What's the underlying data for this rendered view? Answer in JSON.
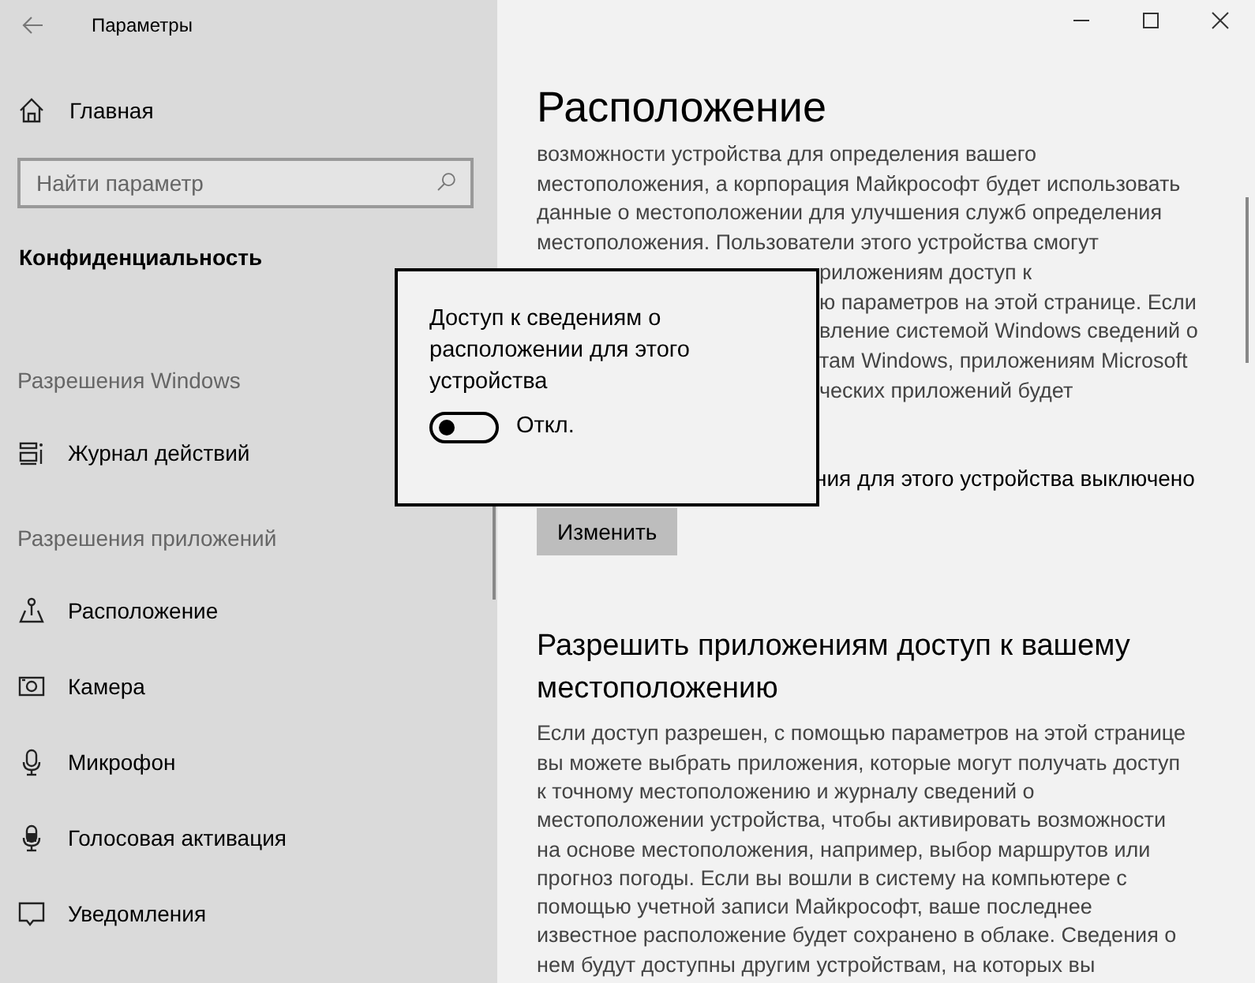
{
  "window": {
    "title": "Параметры"
  },
  "sidebar": {
    "home": "Главная",
    "search": {
      "placeholder": "Найти параметр"
    },
    "section": "Конфиденциальность",
    "groups": [
      {
        "heading": "Разрешения Windows",
        "items": [
          {
            "label": "Журнал действий",
            "kind": "history"
          }
        ]
      },
      {
        "heading": "Разрешения приложений",
        "items": [
          {
            "label": "Расположение",
            "kind": "location"
          },
          {
            "label": "Камера",
            "kind": "camera"
          },
          {
            "label": "Микрофон",
            "kind": "mic"
          },
          {
            "label": "Голосовая активация",
            "kind": "voice"
          },
          {
            "label": "Уведомления",
            "kind": "notify"
          }
        ]
      }
    ]
  },
  "page": {
    "title": "Расположение",
    "intro_lines": [
      {
        "text": "возможности устройства для определения вашего",
        "covered": false
      },
      {
        "text": "местоположения, а корпорация Майкрософт будет использовать",
        "covered": false
      },
      {
        "text": "данные о местоположении для улучшения служб определения",
        "covered": false
      },
      {
        "text": "местоположения. Пользователи этого устройства смогут",
        "covered": false
      },
      {
        "text": "риложениям доступ к",
        "covered": true
      },
      {
        "text": "ю параметров на этой странице. Если",
        "covered": true
      },
      {
        "text": "вление системой Windows сведений о",
        "covered": true
      },
      {
        "text": "там Windows, приложениям Microsoft",
        "covered": true
      },
      {
        "text": "ческих приложений будет",
        "covered": true
      }
    ],
    "status": "ния для этого устройства выключено",
    "change_button": "Изменить",
    "section": {
      "title": "Разрешить приложениям доступ к вашему местоположению",
      "lines": [
        "Если доступ разрешен, с помощью параметров на этой странице",
        "вы можете выбрать приложения, которые могут получать доступ",
        "к точному местоположению и журналу сведений о",
        "местоположении устройства, чтобы активировать возможности",
        "на основе местоположения, например, выбор маршрутов или",
        "прогноз погоды. Если вы вошли в систему на компьютере с",
        "помощью учетной записи Майкрософт, ваше последнее",
        "известное расположение будет сохранено в облаке. Сведения о",
        "нем будут доступны другим устройствам, на которых вы"
      ]
    }
  },
  "dialog": {
    "title": "Доступ к сведениям о расположении для этого устройства",
    "toggle": {
      "on": false,
      "label": "Откл."
    }
  }
}
